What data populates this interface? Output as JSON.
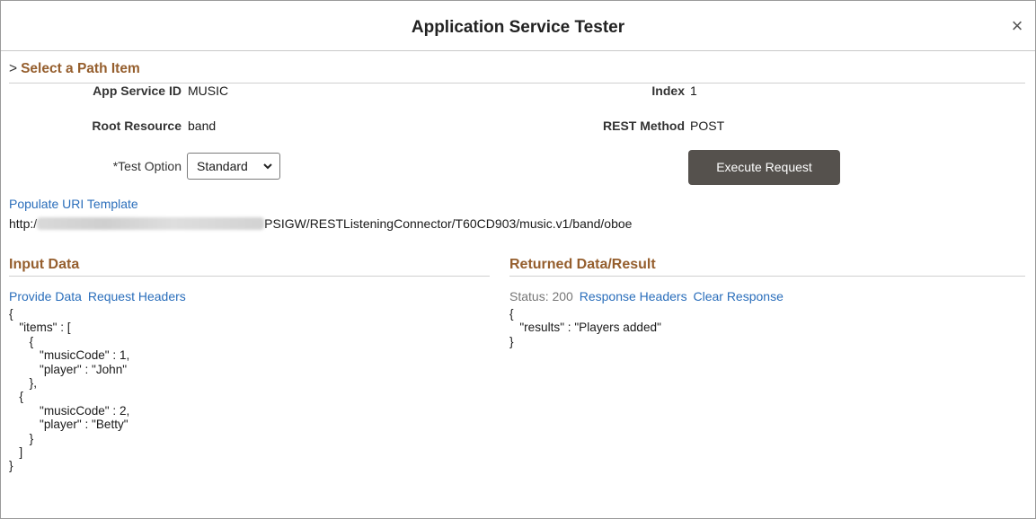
{
  "dialog": {
    "title": "Application Service Tester",
    "close_glyph": "×"
  },
  "path_section": {
    "toggle_glyph": ">",
    "heading": "Select a Path Item"
  },
  "fields": {
    "app_service_id_label": "App Service ID",
    "app_service_id_value": "MUSIC",
    "index_label": "Index",
    "index_value": "1",
    "root_resource_label": "Root Resource",
    "root_resource_value": "band",
    "rest_method_label": "REST Method",
    "rest_method_value": "POST",
    "test_option_label": "*Test Option",
    "test_option_value": "Standard"
  },
  "actions": {
    "execute_label": "Execute Request",
    "populate_uri_label": "Populate URI Template"
  },
  "uri": {
    "prefix": "http:/",
    "suffix": "PSIGW/RESTListeningConnector/T60CD903/music.v1/band/oboe"
  },
  "input_section": {
    "heading": "Input Data",
    "provide_data_label": "Provide Data",
    "request_headers_label": "Request Headers",
    "body": "{\n   \"items\" : [\n      {\n         \"musicCode\" : 1,\n         \"player\" : \"John\"\n      },\n   {\n         \"musicCode\" : 2,\n         \"player\" : \"Betty\"\n      }\n   ]\n}"
  },
  "result_section": {
    "heading": "Returned Data/Result",
    "status_text": "Status: 200",
    "response_headers_label": "Response Headers",
    "clear_response_label": "Clear Response",
    "body": "{\n   \"results\" : \"Players added\"\n}"
  },
  "colors": {
    "section_heading": "#955e2d",
    "link": "#2a6ebb",
    "button_bg": "#55514d"
  },
  "icons": {
    "close": "close-icon",
    "expand": "chevron-right-icon",
    "select": "chevron-down-icon"
  }
}
